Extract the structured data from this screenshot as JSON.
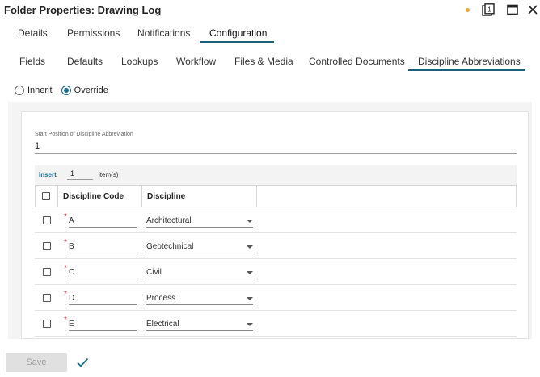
{
  "window": {
    "title": "Folder Properties: Drawing Log",
    "status_dot_color": "#f5a623"
  },
  "tabs_primary": [
    {
      "label": "Details"
    },
    {
      "label": "Permissions"
    },
    {
      "label": "Notifications"
    },
    {
      "label": "Configuration",
      "active": true
    }
  ],
  "tabs_secondary": [
    {
      "label": "Fields"
    },
    {
      "label": "Defaults"
    },
    {
      "label": "Lookups"
    },
    {
      "label": "Workflow"
    },
    {
      "label": "Files & Media"
    },
    {
      "label": "Controlled Documents"
    },
    {
      "label": "Discipline Abbreviations",
      "active": true
    }
  ],
  "mode": {
    "options": [
      "Inherit",
      "Override"
    ],
    "selected": "Override"
  },
  "start_position": {
    "label": "Start Position of Discipline Abbreviation",
    "value": "1"
  },
  "insert": {
    "button_label": "Insert",
    "count": "1",
    "unit": "item(s)"
  },
  "grid": {
    "columns": [
      "Discipline Code",
      "Discipline"
    ],
    "rows": [
      {
        "code": "A",
        "discipline": "Architectural"
      },
      {
        "code": "B",
        "discipline": "Geotechnical"
      },
      {
        "code": "C",
        "discipline": "Civil"
      },
      {
        "code": "D",
        "discipline": "Process"
      },
      {
        "code": "E",
        "discipline": "Electrical"
      }
    ]
  },
  "footer": {
    "save_label": "Save"
  },
  "colors": {
    "accent": "#1b6e8c",
    "required": "#d32f2f"
  }
}
